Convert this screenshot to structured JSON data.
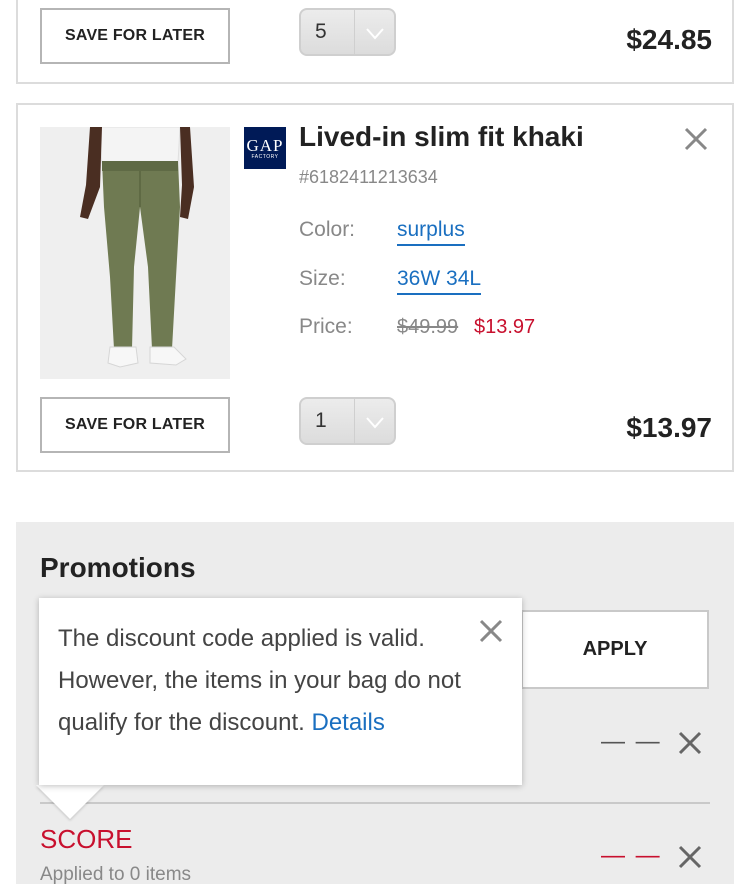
{
  "top_item": {
    "save_label": "SAVE FOR LATER",
    "quantity": "5",
    "total": "$24.85"
  },
  "item": {
    "brand": {
      "line1": "GAP",
      "line2": "FACTORY"
    },
    "title": "Lived-in slim fit khaki",
    "sku": "#6182411213634",
    "color_label": "Color:",
    "color_value": "surplus",
    "size_label": "Size:",
    "size_value": "36W 34L",
    "price_label": "Price:",
    "original_price": "$49.99",
    "sale_price": "$13.97",
    "save_label": "SAVE FOR LATER",
    "quantity": "1",
    "total": "$13.97",
    "remove_icon": "close-icon"
  },
  "promotions": {
    "title": "Promotions",
    "apply_label": "APPLY",
    "row1_amount": "— —",
    "code": "SCORE",
    "code_applied": "Applied to 0 items",
    "code_amount": "— —"
  },
  "tooltip": {
    "message": "The discount code applied is valid. However, the items in your bag do not qualify for the discount. ",
    "link": "Details"
  },
  "colors": {
    "accent_blue": "#1a6fc0",
    "sale_red": "#c8102e",
    "brand_navy": "#001a57",
    "panel_gray": "#ececec"
  }
}
